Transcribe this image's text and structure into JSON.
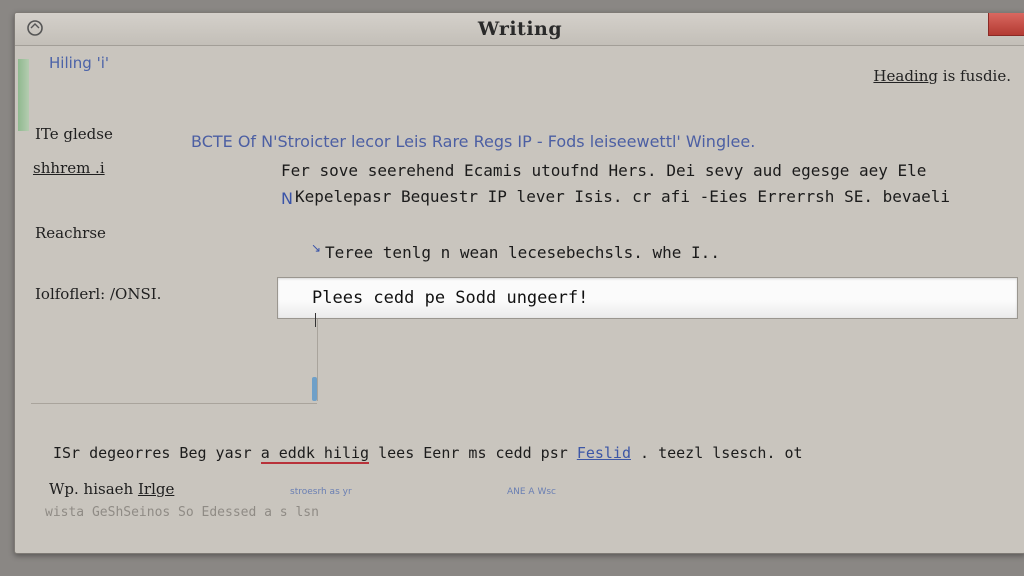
{
  "window": {
    "title": "Writing",
    "app_icon": "app-logo-icon",
    "close_icon": "close-icon"
  },
  "top": {
    "left_link": "Hiling 'i'",
    "right_text_underlined": "Heading",
    "right_text_rest": " is fusdie."
  },
  "left_labels": [
    "ITe gledse",
    "shhrem .i",
    "Reachrse",
    "Iolfoflerl: /ONSI."
  ],
  "main": {
    "heading": "BCTE Of N'Stroicter lecor Leis Rare Regs IP - Fods leiseewettl' Winglee.",
    "line1": "Fer sove seerehend Ecamis utoufnd Hers. Dei sevy aud egesge aey Ele",
    "line2": "Kepelepasr Bequestr IP lever Isis. cr afi -Eies Errerrsh SE. bevaeli",
    "line3": "Teree tenlg n wean lecesebechsls. whe I..",
    "input_value": "Plees cedd pe Sodd ungeerf!",
    "accent_glyph_1": "N",
    "accent_glyph_2": "↘"
  },
  "bottom": {
    "prefix": "ISr degeorres Beg yasr",
    "red_underlined": "a eddk hilig",
    "middle": " lees Eenr ms cedd psr",
    "link": "Feslid",
    "suffix": " . teezl lsesch. ot",
    "sub_prefix": "Wp. hisaeh ",
    "sub_underlined": "Irlge",
    "small_label_1": "stroesrh as yr",
    "small_label_2": "ANE A Wsc",
    "faded": "wista GeShSeinos So Edessed a s lsn"
  },
  "colors": {
    "window_bg": "#c9c5be",
    "link_blue": "#4c5fa3",
    "close_red": "#c0443c",
    "accent_green": "#8fb98f"
  }
}
